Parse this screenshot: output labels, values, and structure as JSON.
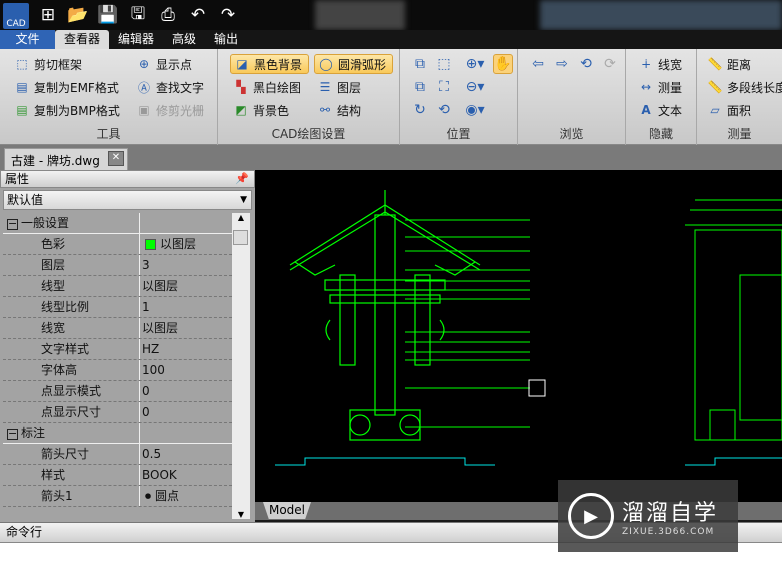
{
  "app": {
    "logo_text": "CAD"
  },
  "quick_access": [
    "new-icon",
    "open-icon",
    "save-icon",
    "save-pdf-icon",
    "print-icon",
    "undo-icon",
    "redo-icon"
  ],
  "menu": {
    "file": "文件",
    "tabs": [
      "查看器",
      "编辑器",
      "高级",
      "输出"
    ]
  },
  "ribbon": {
    "tools": {
      "title": "工具",
      "items": [
        "剪切框架",
        "复制为EMF格式",
        "复制为BMP格式",
        "显示点",
        "查找文字",
        "修剪光栅"
      ]
    },
    "cad_settings": {
      "title": "CAD绘图设置",
      "items": [
        "黑色背景",
        "黑白绘图",
        "背景色",
        "圆滑弧形",
        "图层",
        "结构"
      ]
    },
    "position": {
      "title": "位置"
    },
    "browse": {
      "title": "浏览"
    },
    "hide": {
      "title": "隐藏",
      "items": [
        "线宽",
        "测量",
        "文本"
      ]
    },
    "measure": {
      "title": "测量",
      "items": [
        "距离",
        "多段线长度",
        "面积"
      ]
    }
  },
  "document": {
    "tab": "古建 - 牌坊.dwg"
  },
  "properties": {
    "title": "属性",
    "combo": "默认值",
    "rows": [
      {
        "cat": true,
        "name": "一般设置",
        "value": ""
      },
      {
        "name": "色彩",
        "value": "以图层",
        "swatch": "#00ff00"
      },
      {
        "name": "图层",
        "value": "3"
      },
      {
        "name": "线型",
        "value": "以图层"
      },
      {
        "name": "线型比例",
        "value": "1"
      },
      {
        "name": "线宽",
        "value": "以图层"
      },
      {
        "name": "文字样式",
        "value": "HZ"
      },
      {
        "name": "字体高",
        "value": "100"
      },
      {
        "name": "点显示模式",
        "value": "0"
      },
      {
        "name": "点显示尺寸",
        "value": "0"
      },
      {
        "cat": true,
        "name": "标注",
        "value": ""
      },
      {
        "name": "箭头尺寸",
        "value": "0.5"
      },
      {
        "name": "样式",
        "value": "BOOK"
      },
      {
        "name": "箭头1",
        "value": "圆点"
      }
    ]
  },
  "layout_tab": "Model",
  "command": {
    "title": "命令行"
  },
  "watermark": {
    "title": "溜溜自学",
    "url": "ZIXUE.3D66.COM"
  },
  "colors": {
    "drawing_green": "#00ff00",
    "drawing_cyan": "#00e5e5",
    "accent": "#2f64b5"
  }
}
